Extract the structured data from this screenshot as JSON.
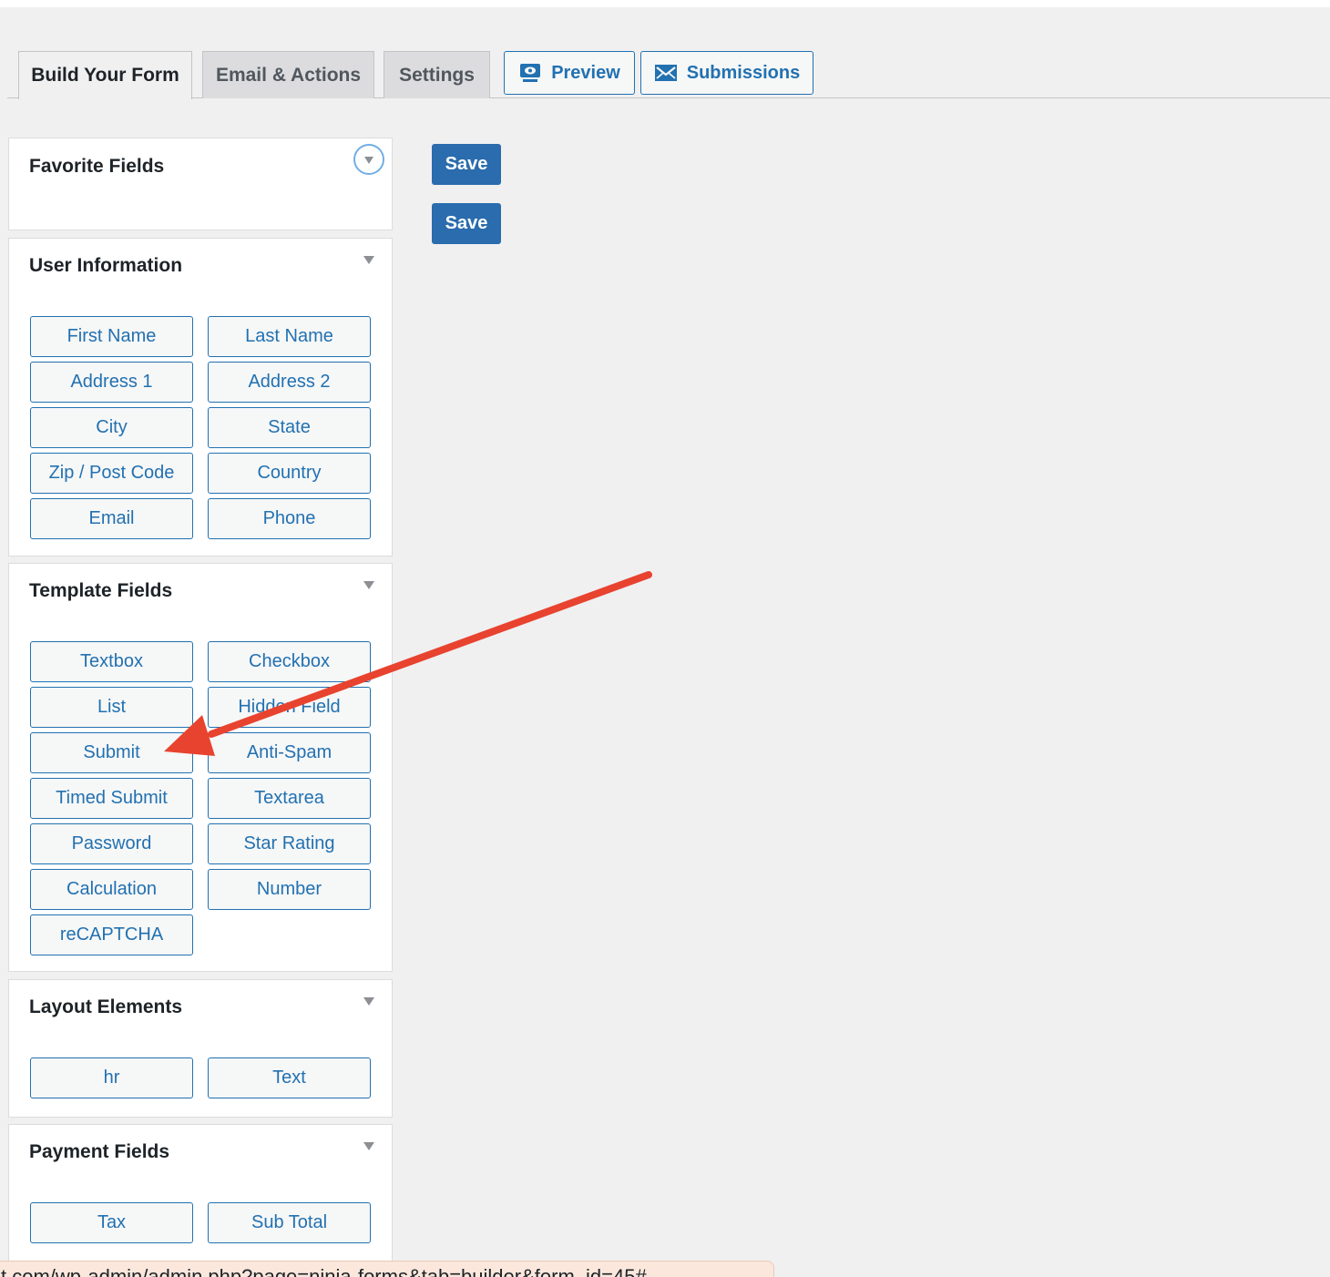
{
  "tabs": [
    {
      "label": "Build Your Form",
      "active": true
    },
    {
      "label": "Email & Actions",
      "active": false
    },
    {
      "label": "Settings",
      "active": false
    }
  ],
  "tab_buttons": {
    "preview": {
      "label": "Preview",
      "icon": "preview-screen-icon"
    },
    "submissions": {
      "label": "Submissions",
      "icon": "envelope-icon"
    }
  },
  "save_buttons": [
    "Save",
    "Save"
  ],
  "panels": {
    "favorite": {
      "title": "Favorite Fields"
    },
    "user_info": {
      "title": "User Information",
      "fields": [
        "First Name",
        "Last Name",
        "Address 1",
        "Address 2",
        "City",
        "State",
        "Zip / Post Code",
        "Country",
        "Email",
        "Phone"
      ]
    },
    "template": {
      "title": "Template Fields",
      "fields": [
        "Textbox",
        "Checkbox",
        "List",
        "Hidden Field",
        "Submit",
        "Anti-Spam",
        "Timed Submit",
        "Textarea",
        "Password",
        "Star Rating",
        "Calculation",
        "Number",
        "reCAPTCHA"
      ]
    },
    "layout": {
      "title": "Layout Elements",
      "fields": [
        "hr",
        "Text"
      ]
    },
    "payment": {
      "title": "Payment Fields",
      "fields": [
        "Tax",
        "Sub Total"
      ]
    }
  },
  "status_url": "t.com/wp-admin/admin.php?page=ninja-forms&tab=builder&form_id=45#",
  "colors": {
    "accent": "#2271b1",
    "save": "#2a6cad",
    "annotation_arrow": "#e8432f",
    "background": "#f0f0f1"
  }
}
